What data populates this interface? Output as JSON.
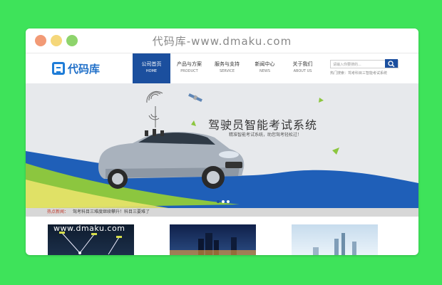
{
  "window": {
    "title": "代码库-www.dmaku.com"
  },
  "logo": {
    "text": "代码库"
  },
  "nav": [
    {
      "cn": "公司首页",
      "en": "HOME",
      "active": true
    },
    {
      "cn": "产品与方案",
      "en": "PRODUCT",
      "active": false
    },
    {
      "cn": "服务与支持",
      "en": "SERVICE",
      "active": false
    },
    {
      "cn": "新闻中心",
      "en": "NEWS",
      "active": false
    },
    {
      "cn": "关于我们",
      "en": "ABOUT US",
      "active": false
    }
  ],
  "search": {
    "placeholder": "请输入你要搜的...",
    "hot_search": "热门搜索：驾考科目三智能考试系统"
  },
  "banner": {
    "title": "驾驶员智能考试系统",
    "subtitle": "精准智能考试系统，助您驾考轻松过！"
  },
  "hotnews": {
    "label": "热点新闻：",
    "text": "驾考科目三难度继续攀升！科目三要难了"
  },
  "cards_watermark": "www.dmaku.com",
  "colors": {
    "page_bg": "#3ee35a",
    "brand_blue": "#1b4f9e",
    "logo_blue": "#1f6fc8",
    "accent_green": "#8cc63f"
  }
}
